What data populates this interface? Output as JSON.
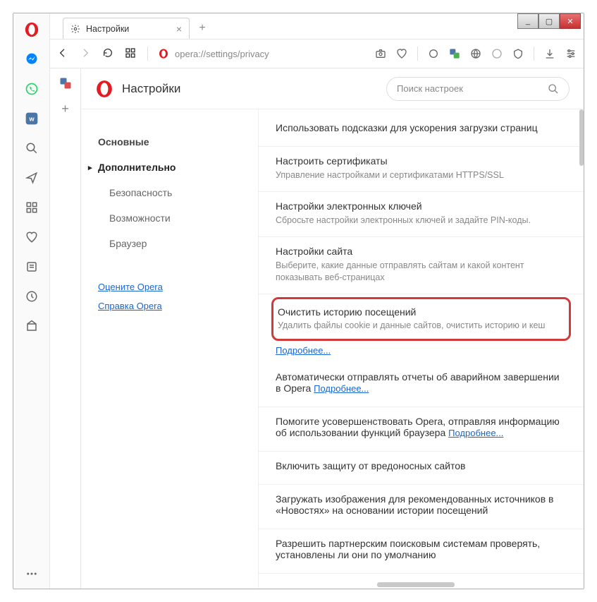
{
  "window": {
    "min": "_",
    "max": "▢",
    "close": "✕"
  },
  "tab": {
    "title": "Настройки"
  },
  "address": {
    "scheme": "opera://",
    "path": "settings/privacy"
  },
  "settings_header": {
    "title": "Настройки"
  },
  "search": {
    "placeholder": "Поиск настроек"
  },
  "leftnav": {
    "basic": "Основные",
    "advanced": "Дополнительно",
    "security": "Безопасность",
    "features": "Возможности",
    "browser": "Браузер",
    "rate": "Оцените Opera",
    "help": "Справка Opera"
  },
  "rows": {
    "r0": {
      "t": "Использовать подсказки для ускорения загрузки страниц"
    },
    "r1": {
      "t": "Настроить сертификаты",
      "d": "Управление настройками и сертификатами HTTPS/SSL"
    },
    "r2": {
      "t": "Настройки электронных ключей",
      "d": "Сбросьте настройки электронных ключей и задайте PIN-коды."
    },
    "r3": {
      "t": "Настройки сайта",
      "d": "Выберите, какие данные отправлять сайтам и какой контент показывать веб-страницах"
    },
    "hl": {
      "t": "Очистить историю посещений",
      "d": "Удалить файлы cookie и данные сайтов, очистить историю и кеш"
    },
    "more": "Подробнее...",
    "r5a": "Автоматически отправлять отчеты об аварийном завершении в Opera  ",
    "r5b": "Подробнее...",
    "r6a": "Помогите усовершенствовать Opera, отправляя информацию об использовании функций браузера  ",
    "r6b": "Подробнее...",
    "r7": {
      "t": "Включить защиту от вредоносных сайтов"
    },
    "r8": {
      "t": "Загружать изображения для рекомендованных источников в «Новостях» на основании истории посещений"
    },
    "r9": {
      "t": "Разрешить партнерским поисковым системам проверять, установлены ли они по умолчанию"
    }
  }
}
